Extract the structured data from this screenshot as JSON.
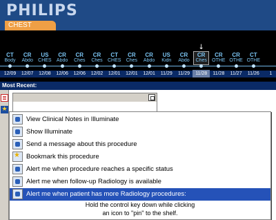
{
  "header": {
    "logo": "PHILIPS",
    "section_tab": "CHEST"
  },
  "timeline": {
    "selected_index": 11,
    "items": [
      {
        "modality": "CT",
        "body_part": "Body",
        "date": "12/09"
      },
      {
        "modality": "CR",
        "body_part": "Abdo",
        "date": "12/07"
      },
      {
        "modality": "US",
        "body_part": "CHES",
        "date": "12/08"
      },
      {
        "modality": "CR",
        "body_part": "Abdo",
        "date": "12/06"
      },
      {
        "modality": "CR",
        "body_part": "Ches",
        "date": "12/06"
      },
      {
        "modality": "CR",
        "body_part": "Ches",
        "date": "12/02"
      },
      {
        "modality": "CT",
        "body_part": "CHES",
        "date": "12/01"
      },
      {
        "modality": "CR",
        "body_part": "Ches",
        "date": "12/01"
      },
      {
        "modality": "CR",
        "body_part": "Abdo",
        "date": "12/01"
      },
      {
        "modality": "US",
        "body_part": "Kidn",
        "date": "11/29"
      },
      {
        "modality": "CR",
        "body_part": "Abdo",
        "date": "11/29"
      },
      {
        "modality": "CR",
        "body_part": "Ches",
        "date": "11/28"
      },
      {
        "modality": "CR",
        "body_part": "OTHE",
        "date": "11/28"
      },
      {
        "modality": "CR",
        "body_part": "OTHE",
        "date": "11/27"
      },
      {
        "modality": "CT",
        "body_part": "OTHE",
        "date": "11/26"
      },
      {
        "modality": "",
        "body_part": "",
        "date": "1"
      }
    ]
  },
  "most_recent_label": "Most Recent:",
  "menu": {
    "items": [
      {
        "label": "View Clinical Notes in Illuminate",
        "icon": "notes-icon",
        "highlighted": false
      },
      {
        "label": "Show Illuminate",
        "icon": "illuminate-icon",
        "highlighted": false
      },
      {
        "label": "Send a message about this procedure",
        "icon": "message-icon",
        "highlighted": false
      },
      {
        "label": "Bookmark this procedure",
        "icon": "bookmark-icon",
        "highlighted": false
      },
      {
        "label": "Alert me when procedure reaches a specific status",
        "icon": "alert-status-icon",
        "highlighted": false
      },
      {
        "label": "Alert me when follow-up Radiology is available",
        "icon": "alert-followup-icon",
        "highlighted": false
      },
      {
        "label": "Alert me when patient has more Radiology procedures:",
        "icon": "alert-more-procedures-icon",
        "highlighted": true
      }
    ],
    "hint_line1": "Hold the control key down while clicking",
    "hint_line2": "an icon to \"pin\" to the shelf."
  },
  "colors": {
    "header_bg": "#1f4a86",
    "tab_orange": "#ef9f45",
    "timeline_text": "#7cc6f5",
    "highlight": "#2552b8"
  }
}
